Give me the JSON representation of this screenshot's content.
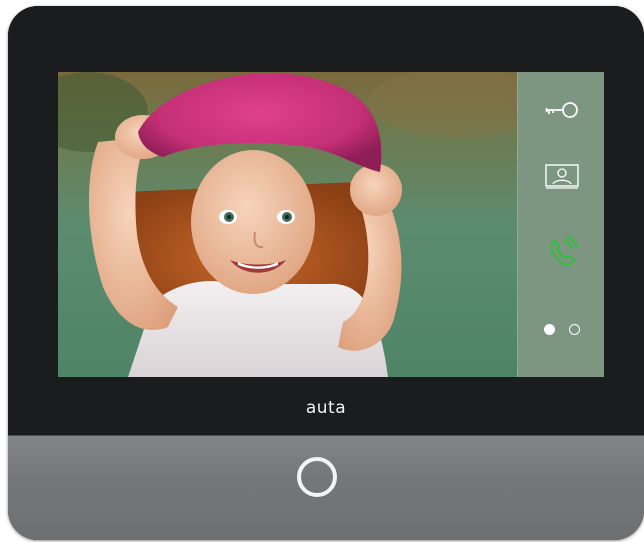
{
  "device": {
    "brand": "auta",
    "frame_color": "#1b1c1e",
    "bottom_panel_color": "#77787a"
  },
  "screen": {
    "sidebar": {
      "buttons": [
        {
          "name": "unlock",
          "icon": "key-icon",
          "color": "#ffffff"
        },
        {
          "name": "visitor-camera",
          "icon": "visitor-portrait-icon",
          "color": "#ffffff"
        },
        {
          "name": "answer-call",
          "icon": "phone-call-icon",
          "color": "#2fbf3a"
        }
      ],
      "pagination": {
        "pages": 2,
        "current": 1
      }
    },
    "camera_feed": {
      "subject": "child-with-pink-hat"
    }
  },
  "home_button": {
    "icon": "home-ring-icon"
  }
}
